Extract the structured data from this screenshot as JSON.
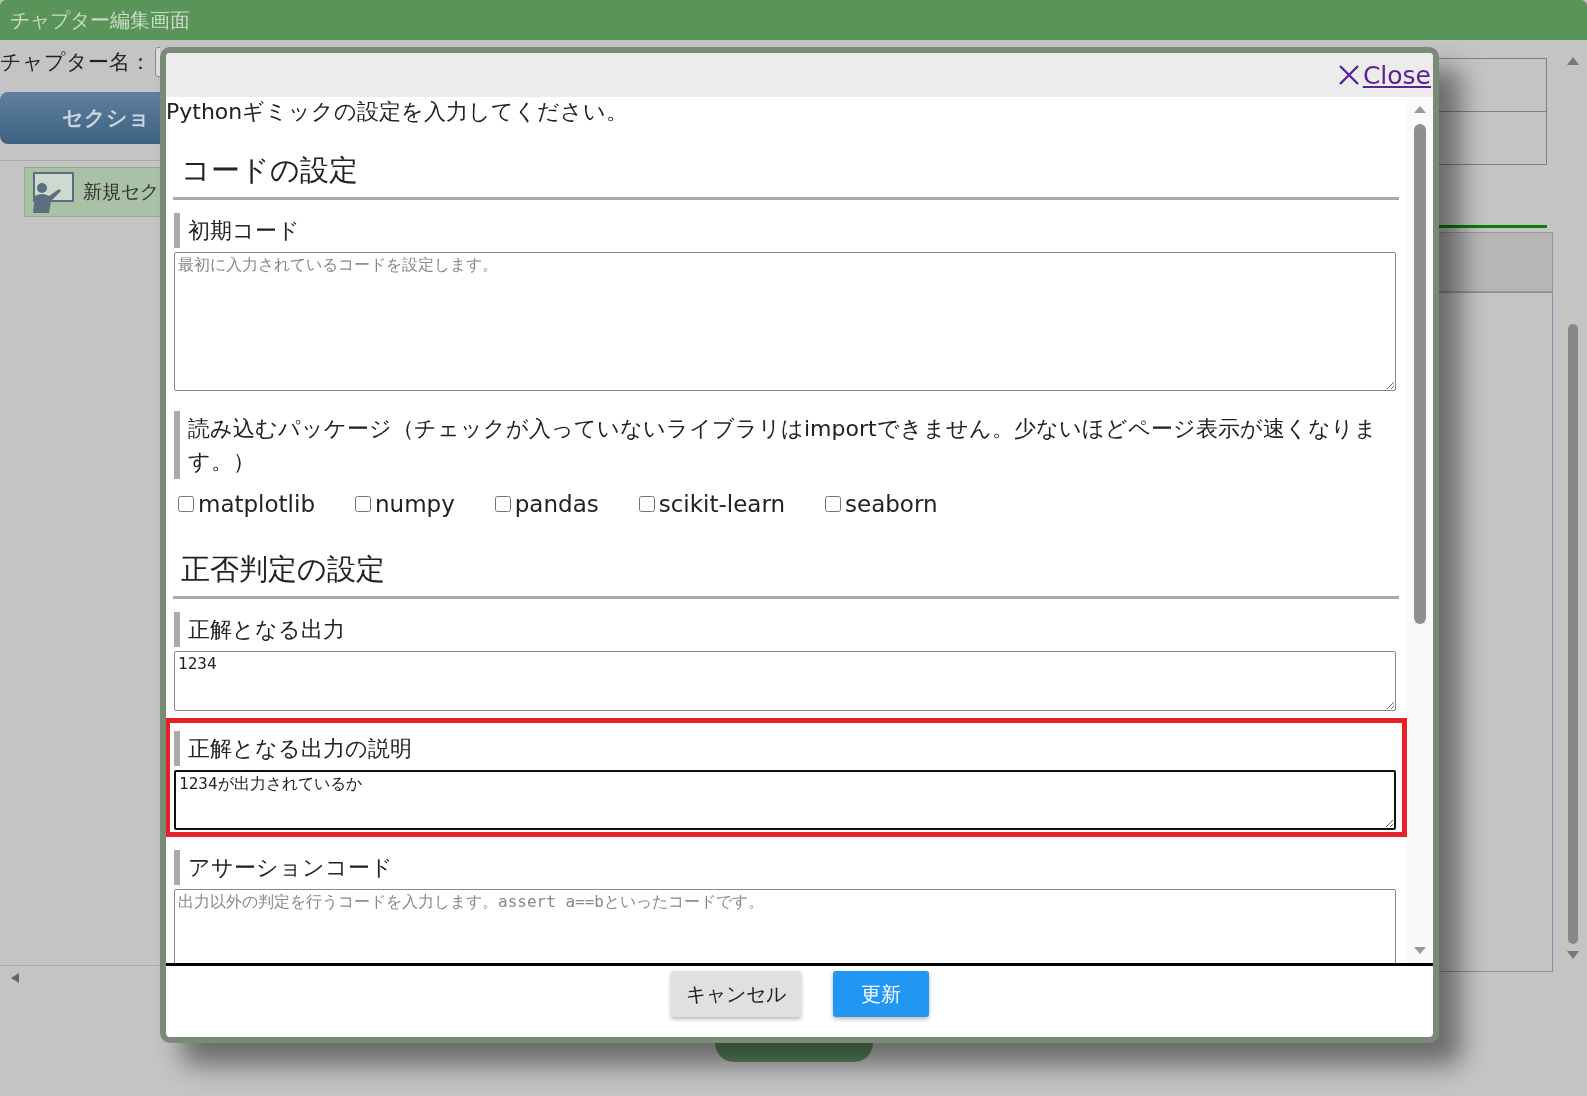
{
  "window": {
    "title": "チャプター編集画面"
  },
  "chapter_name": {
    "label": "チャプター名："
  },
  "section_button": {
    "label": "セクショ"
  },
  "section_item": {
    "label": "新規セク"
  },
  "dialog": {
    "close_label": "Close",
    "intro": "Pythonギミックの設定を入力してください。",
    "sections": [
      {
        "heading": "コードの設定",
        "fields": [
          {
            "kind": "code",
            "label": "初期コード",
            "placeholder": "最初に入力されているコードを設定します。"
          },
          {
            "kind": "checkboxes",
            "label": "読み込むパッケージ（チェックが入っていないライブラリはimportできません。少ないほどページ表示が速くなります。）",
            "options": [
              {
                "label": "matplotlib",
                "checked": false
              },
              {
                "label": "numpy",
                "checked": false
              },
              {
                "label": "pandas",
                "checked": false
              },
              {
                "label": "scikit-learn",
                "checked": false
              },
              {
                "label": "seaborn",
                "checked": false
              }
            ]
          }
        ]
      },
      {
        "heading": "正否判定の設定",
        "fields": [
          {
            "kind": "text",
            "label": "正解となる出力",
            "value": "1234",
            "focused": false,
            "highlighted": false
          },
          {
            "kind": "text",
            "label": "正解となる出力の説明",
            "value": "1234が出力されているか",
            "focused": true,
            "highlighted": true
          },
          {
            "kind": "code",
            "label": "アサーションコード",
            "placeholder": "出力以外の判定を行うコードを入力します。assert a==bといったコードです。"
          }
        ]
      }
    ],
    "buttons": [
      {
        "label": "キャンセル",
        "kind": "secondary"
      },
      {
        "label": "更新",
        "kind": "primary"
      }
    ]
  }
}
